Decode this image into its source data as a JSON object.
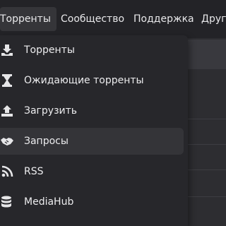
{
  "nav": {
    "items": [
      {
        "label": "Торренты"
      },
      {
        "label": "Сообщество"
      },
      {
        "label": "Поддержка"
      },
      {
        "label": "Друго"
      }
    ]
  },
  "dropdown": {
    "items": [
      {
        "label": "Торренты",
        "icon": "download-icon"
      },
      {
        "label": "Ожидающие торренты",
        "icon": "hourglass-icon"
      },
      {
        "label": "Загрузить",
        "icon": "upload-icon"
      },
      {
        "label": "Запросы",
        "icon": "handshake-icon"
      },
      {
        "label": "RSS",
        "icon": "rss-icon"
      },
      {
        "label": "MediaHub",
        "icon": "database-icon"
      }
    ]
  },
  "colors": {
    "background": "#2b2b2f",
    "menu_background": "#27272b",
    "hover": "#343438",
    "text": "#ececee"
  }
}
